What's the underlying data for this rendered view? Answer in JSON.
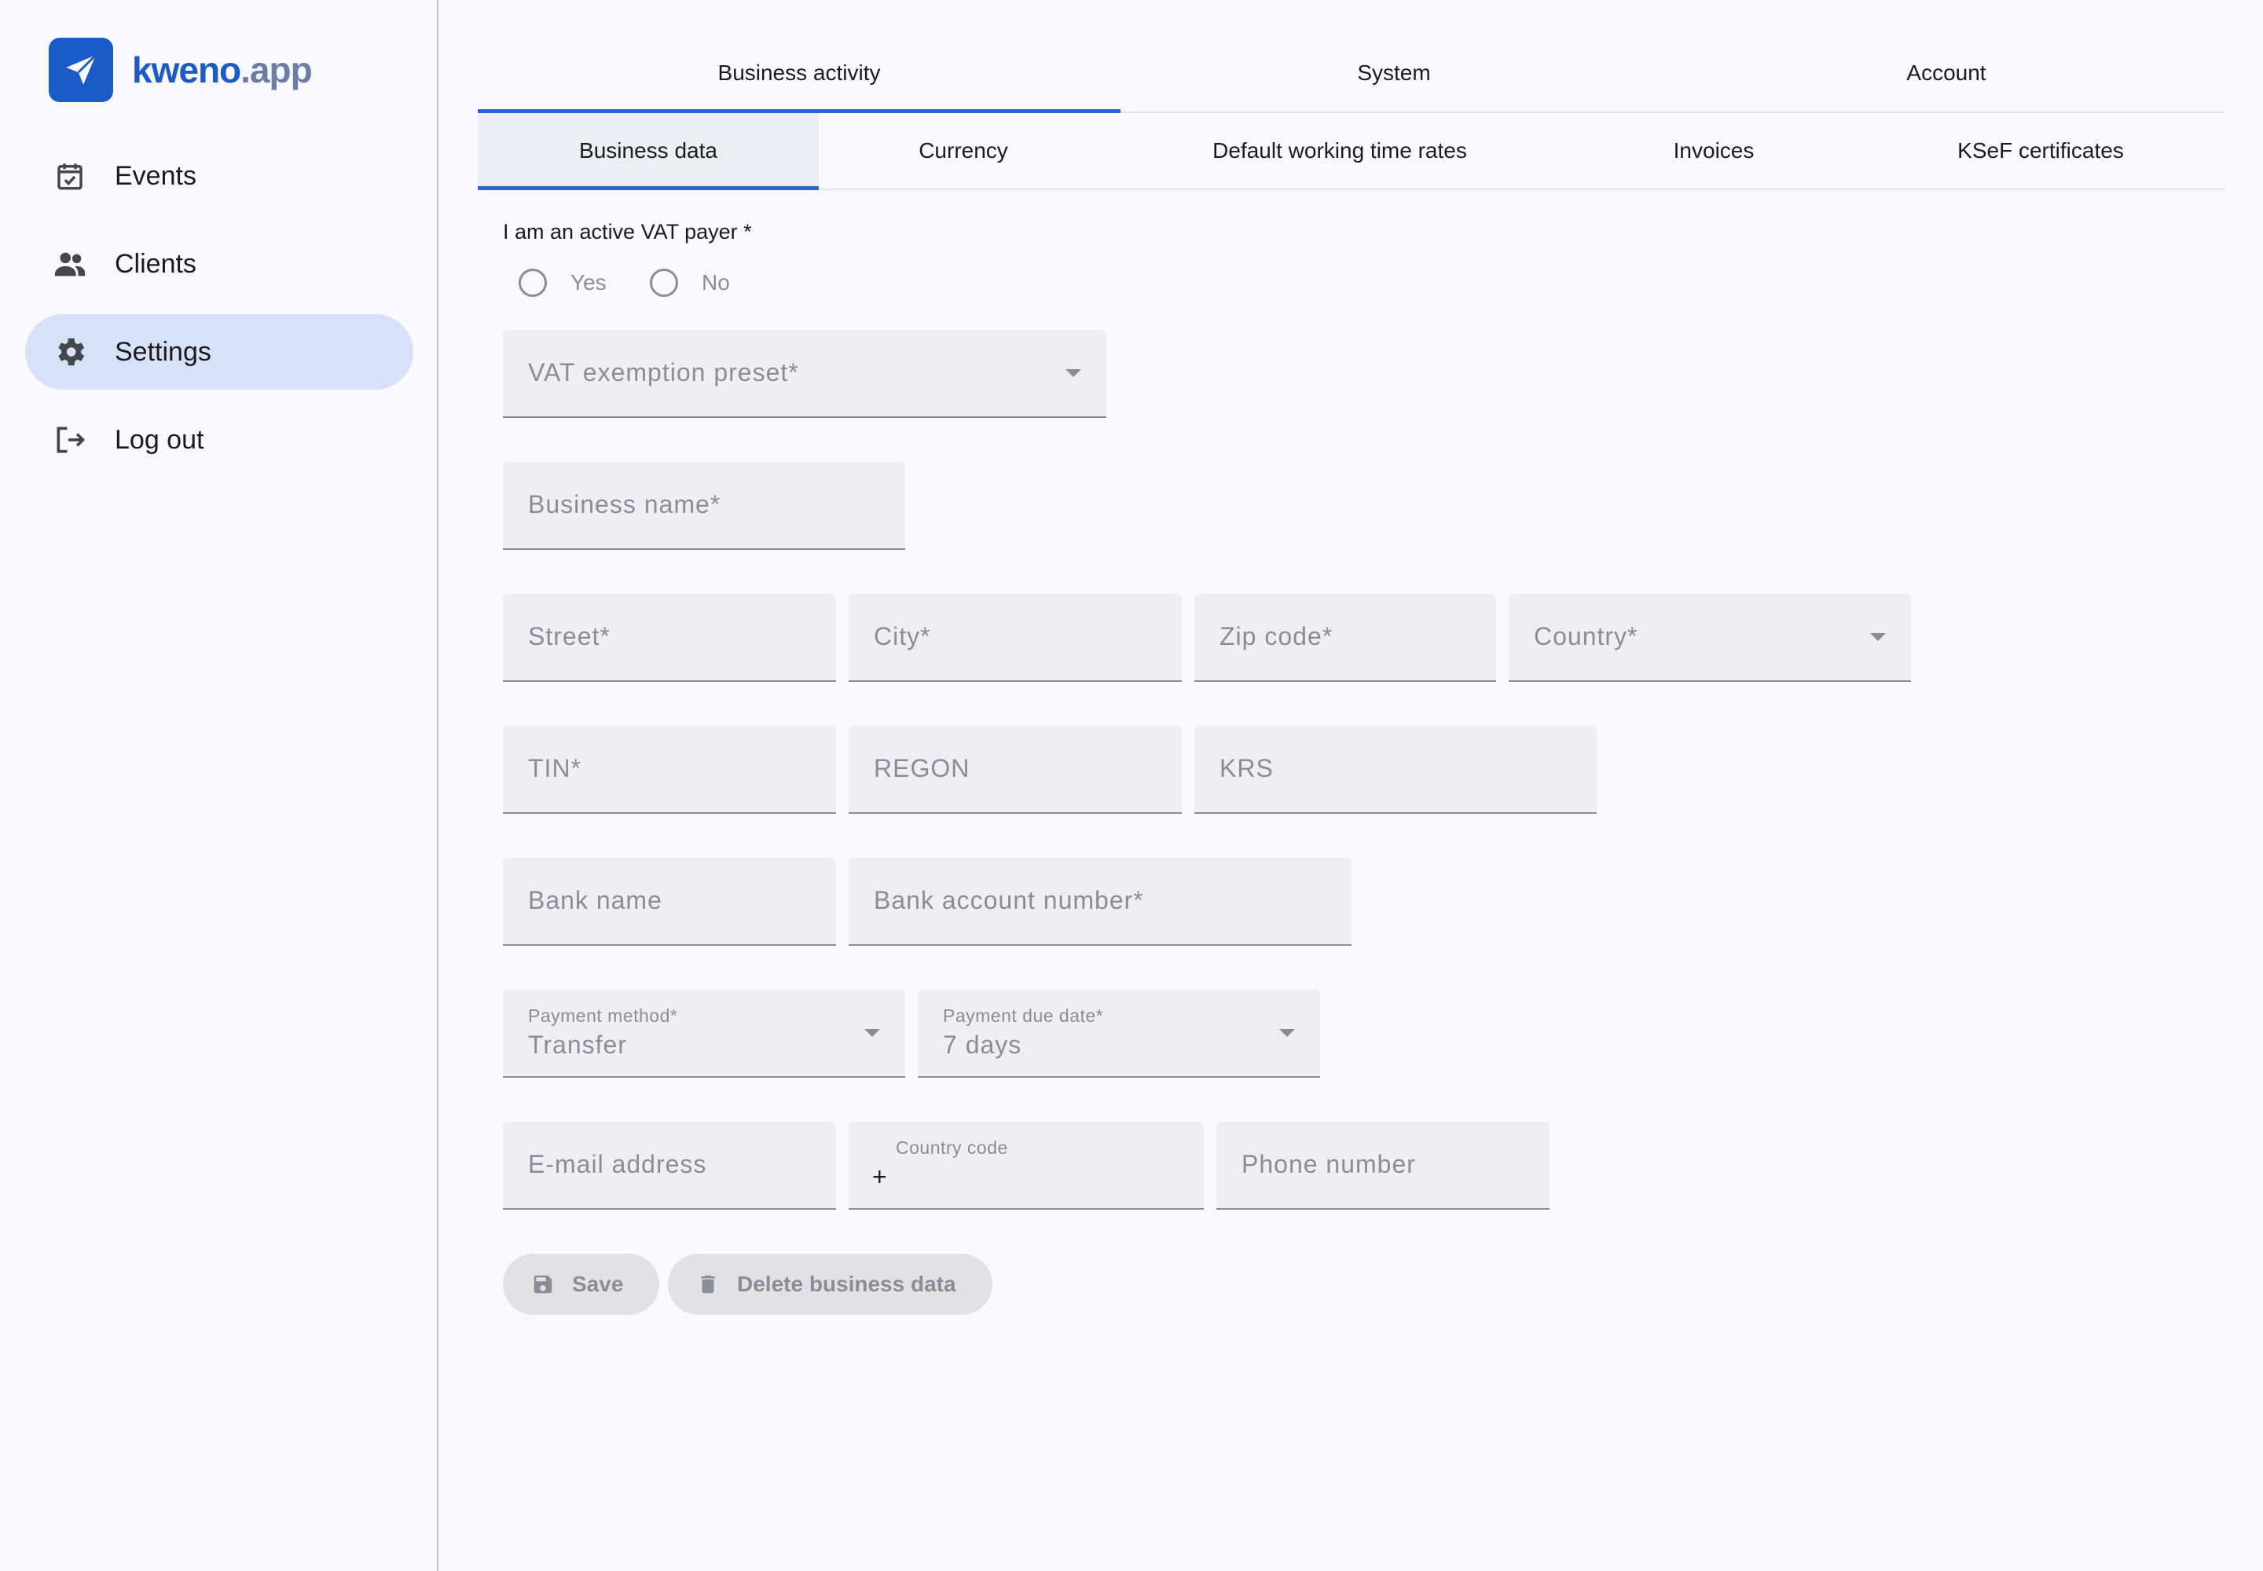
{
  "brand": {
    "name": "kweno",
    "tld": ".app",
    "logo_icon": "paper-plane-icon"
  },
  "sidebar": {
    "items": [
      {
        "label": "Events",
        "icon": "calendar-check-icon",
        "active": false
      },
      {
        "label": "Clients",
        "icon": "people-icon",
        "active": false
      },
      {
        "label": "Settings",
        "icon": "gear-icon",
        "active": true
      },
      {
        "label": "Log out",
        "icon": "logout-icon",
        "active": false
      }
    ]
  },
  "tabs_primary": [
    {
      "label": "Business activity",
      "active": true
    },
    {
      "label": "System",
      "active": false
    },
    {
      "label": "Account",
      "active": false
    }
  ],
  "tabs_secondary": [
    {
      "label": "Business data",
      "active": true
    },
    {
      "label": "Currency",
      "active": false
    },
    {
      "label": "Default working time rates",
      "active": false
    },
    {
      "label": "Invoices",
      "active": false
    },
    {
      "label": "KSeF certificates",
      "active": false
    }
  ],
  "form": {
    "vat_payer": {
      "label": "I am an active VAT payer *",
      "options": [
        "Yes",
        "No"
      ]
    },
    "vat_exemption": {
      "placeholder": "VAT exemption preset*"
    },
    "business_name": {
      "placeholder": "Business name*"
    },
    "street": {
      "placeholder": "Street*"
    },
    "city": {
      "placeholder": "City*"
    },
    "zip": {
      "placeholder": "Zip code*"
    },
    "country": {
      "placeholder": "Country*"
    },
    "tin": {
      "placeholder": "TIN*"
    },
    "regon": {
      "placeholder": "REGON"
    },
    "krs": {
      "placeholder": "KRS"
    },
    "bank_name": {
      "placeholder": "Bank name"
    },
    "bank_account": {
      "placeholder": "Bank account number*"
    },
    "payment_method": {
      "label": "Payment method*",
      "value": "Transfer"
    },
    "payment_due": {
      "label": "Payment due date*",
      "value": "7 days"
    },
    "email": {
      "placeholder": "E-mail address"
    },
    "country_code": {
      "label": "Country code",
      "value": "+"
    },
    "phone": {
      "placeholder": "Phone number"
    }
  },
  "actions": {
    "save_label": "Save",
    "delete_label": "Delete business data"
  },
  "colors": {
    "accent": "#2c62c9",
    "brand": "#1a5bc8",
    "nav_active": "#d7e2f9"
  }
}
